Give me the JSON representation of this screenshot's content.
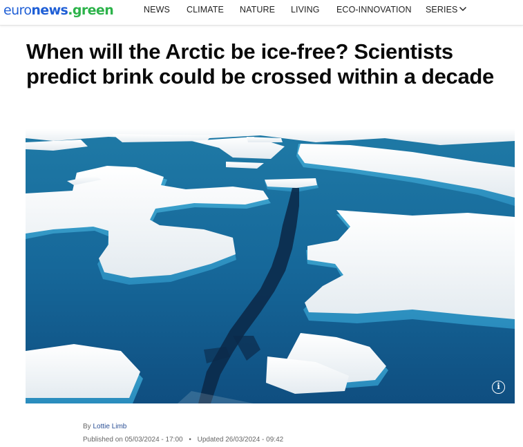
{
  "header": {
    "logo": {
      "part1": "euro",
      "part2": "news",
      "part3": ".green"
    },
    "nav": [
      {
        "label": "NEWS"
      },
      {
        "label": "CLIMATE"
      },
      {
        "label": "NATURE"
      },
      {
        "label": "LIVING"
      },
      {
        "label": "ECO-INNOVATION"
      },
      {
        "label": "SERIES"
      }
    ],
    "series_icon": "chevron-down-icon"
  },
  "article": {
    "title": "When will the Arctic be ice-free? Scientists predict brink could be crossed within a decade",
    "image": {
      "description_icon": "info-icon",
      "colors": {
        "water": "#1a6f98",
        "ice": "#f2f5f7",
        "crack": "#0b2a4a"
      }
    },
    "byline": {
      "prefix": "By",
      "author": "Lottie Limb"
    },
    "published": "Published on 05/03/2024 - 17:00",
    "updated": "Updated 26/03/2024 - 09:42",
    "separator": "•"
  }
}
